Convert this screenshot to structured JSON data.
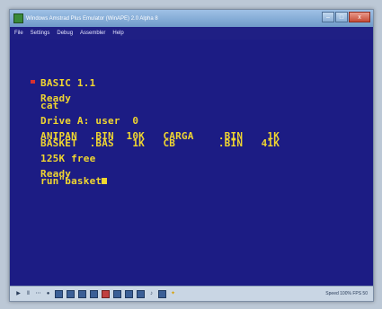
{
  "window": {
    "title": "Windows Amstrad Plus Emulator (WinAPE) 2.0 Alpha 8",
    "controls": {
      "minimize": "–",
      "maximize": "□",
      "close": "x"
    }
  },
  "menu": [
    "File",
    "Settings",
    "Debug",
    "Assembler",
    "Help"
  ],
  "screen": {
    "basic_header": "BASIC 1.1",
    "ready1": "Ready",
    "cmd1": "cat",
    "drive": "Drive A: user  0",
    "dir_row1": "ANIPAN  .BIN  10K   CARGA    .BIN    1K",
    "dir_row2": "BASKET  .BAS   1K   CB       .BIN   41K",
    "free": "125K free",
    "ready2": "Ready",
    "cmd2": "run\"basket"
  },
  "status": {
    "speed": "Speed 100% FPS 50",
    "icons": [
      "play-icon",
      "pause-icon",
      "step-icon",
      "record-icon",
      "disk-icon",
      "tape-icon",
      "save-icon",
      "floppy-icon",
      "chip-icon",
      "image-icon",
      "printer-icon",
      "snapshot-icon",
      "sound-icon",
      "joystick-icon",
      "warning-icon"
    ]
  }
}
